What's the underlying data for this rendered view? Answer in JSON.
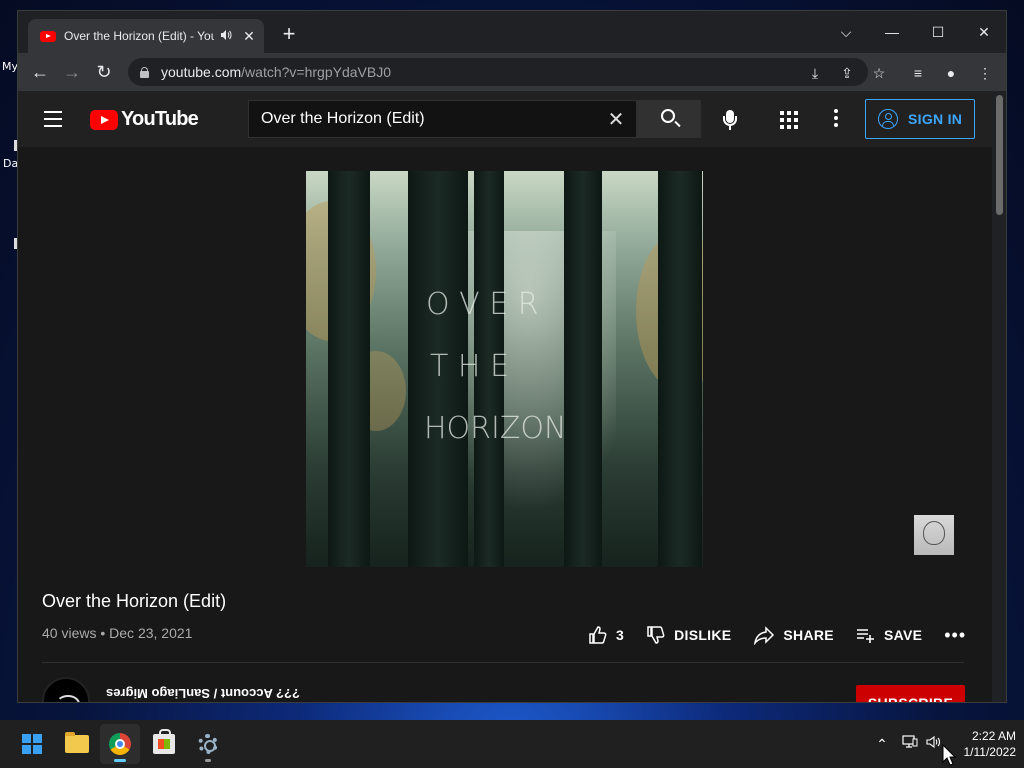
{
  "desktop": {
    "icon_labels": [
      "My",
      "Da"
    ]
  },
  "browser": {
    "tab_title": "Over the Horizon (Edit) - YouTube",
    "audio_icon": "speaker-icon",
    "close_glyph": "✕",
    "new_tab_glyph": "+",
    "window_controls": {
      "tabsearch": "⌵",
      "minimize": "—",
      "maximize": "☐",
      "close": "✕"
    },
    "url_host": "youtube.com",
    "url_path": "/watch?v=hrgpYdaVBJ0"
  },
  "youtube": {
    "logo_text": "YouTube",
    "search_query": "Over the Horizon (Edit)",
    "signin_label": "SIGN IN",
    "poster": {
      "line1": "O V E R",
      "line2": "T H E",
      "line3": "HORIZON"
    },
    "video_title": "Over the Horizon (Edit)",
    "views": "40 views",
    "date": "Dec 23, 2021",
    "likes": "3",
    "dislike_label": "DISLIKE",
    "share_label": "SHARE",
    "save_label": "SAVE",
    "more_glyph": "•••",
    "channel_name": "??? Account / SanLiago Migres",
    "subscribe_label": "SUBSCRIBE"
  },
  "taskbar": {
    "apps": [
      "start",
      "file-explorer",
      "chrome",
      "microsoft-store",
      "settings"
    ],
    "time": "2:22 AM",
    "date": "1/11/2022",
    "colors": {
      "accent": "#60cdff"
    }
  },
  "colors": {
    "yt_red": "#ff0000",
    "yt_blue": "#3ea6ff",
    "subscribe_red": "#cc0000"
  }
}
